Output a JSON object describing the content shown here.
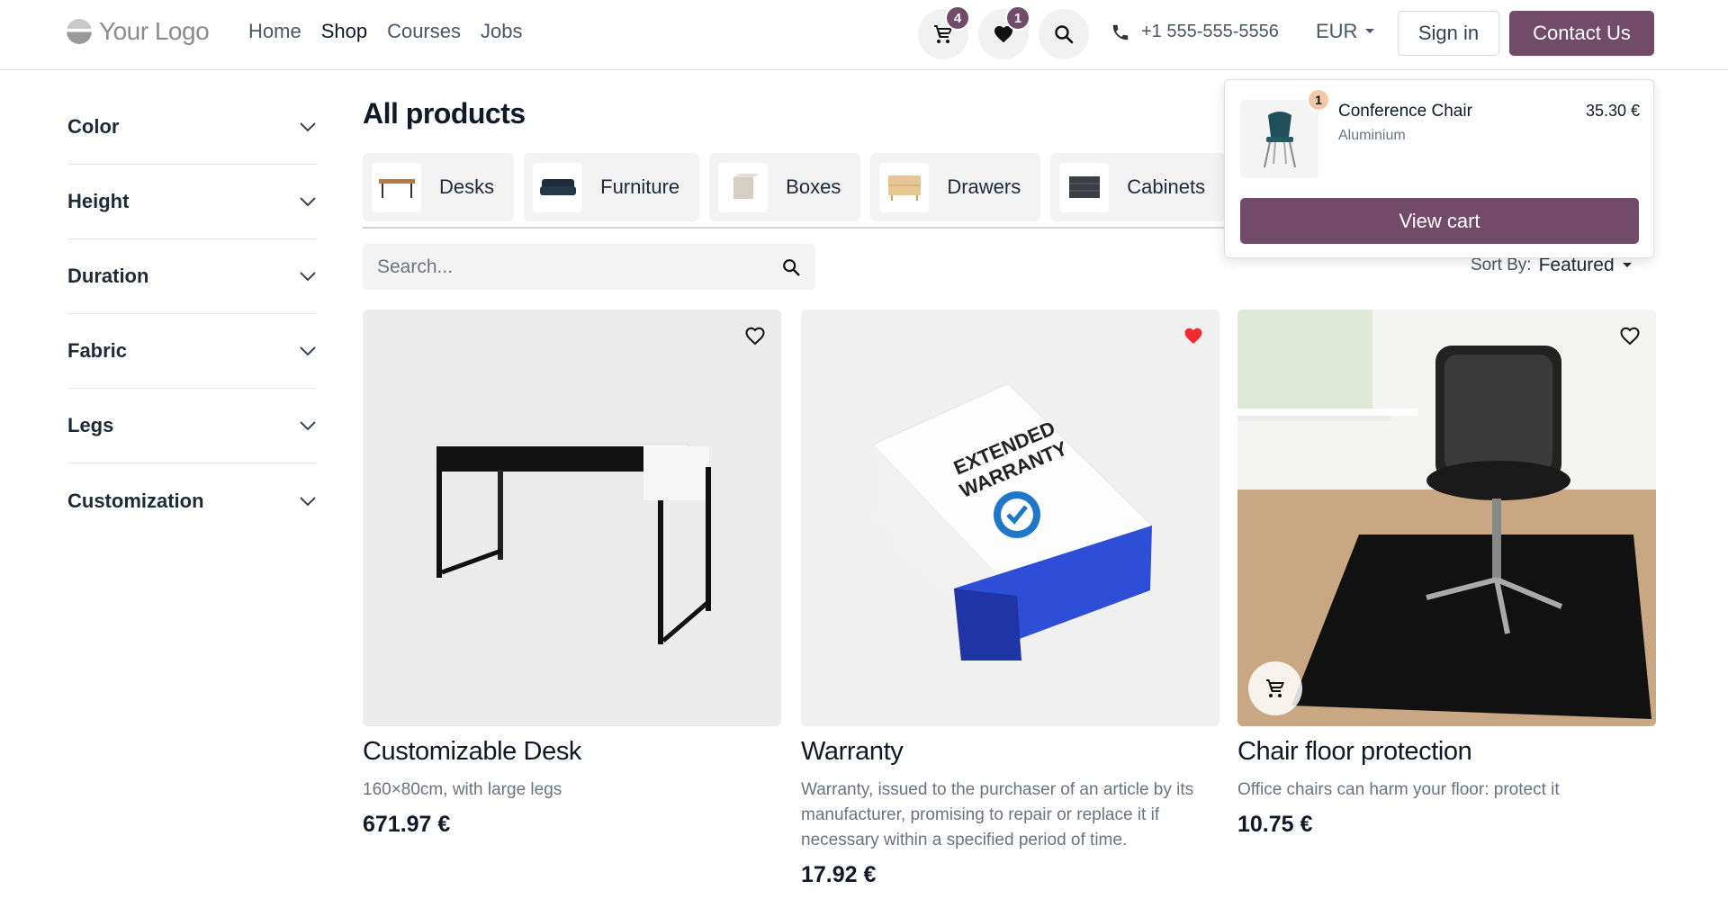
{
  "header": {
    "logo_text": "Your Logo",
    "nav": [
      "Home",
      "Shop",
      "Courses",
      "Jobs"
    ],
    "active_nav": "Shop",
    "cart_count": "4",
    "wishlist_count": "1",
    "phone": "+1 555-555-5556",
    "currency": "EUR",
    "signin_label": "Sign in",
    "contact_label": "Contact Us"
  },
  "sidebar": {
    "filters": [
      {
        "label": "Color"
      },
      {
        "label": "Height"
      },
      {
        "label": "Duration"
      },
      {
        "label": "Fabric"
      },
      {
        "label": "Legs"
      },
      {
        "label": "Customization"
      }
    ]
  },
  "main": {
    "title": "All products",
    "categories": [
      "Desks",
      "Furniture",
      "Boxes",
      "Drawers",
      "Cabinets"
    ],
    "search_placeholder": "Search...",
    "sort_label": "Sort By:",
    "sort_value": "Featured"
  },
  "products": [
    {
      "name": "Customizable Desk",
      "desc": "160×80cm, with large legs",
      "price": "671.97 €",
      "wishlisted": false
    },
    {
      "name": "Warranty",
      "desc": "Warranty, issued to the purchaser of an article by its manufacturer, promising to repair or replace it if necessary within a specified period of time.",
      "price": "17.92 €",
      "wishlisted": true,
      "box_text": "EXTENDED WARRANTY"
    },
    {
      "name": "Chair floor protection",
      "desc": "Office chairs can harm your floor: protect it",
      "price": "10.75 €",
      "wishlisted": false
    }
  ],
  "cart_popover": {
    "item_name": "Conference Chair",
    "item_variant": "Aluminium",
    "item_qty": "1",
    "item_price": "35.30 €",
    "view_cart_label": "View cart"
  },
  "colors": {
    "brand": "#714b67",
    "wishlist_active": "#ef2b2b"
  }
}
